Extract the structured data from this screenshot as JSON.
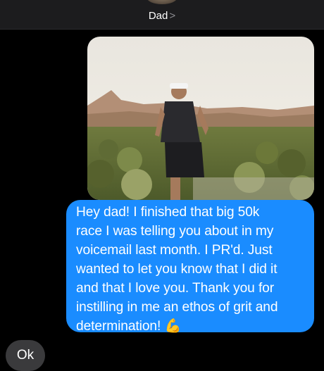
{
  "header": {
    "contact_name": "Dad",
    "chevron": ">"
  },
  "photo_message": {
    "subject": "man running on trail"
  },
  "sent_message": {
    "lines": [
      "Hey dad! I finished that big 50k",
      "race I was telling you about in my",
      "voicemail last month. I PR'd. Just",
      "wanted to let you know that I did it",
      "and that I love you. Thank you for",
      "instilling in me an ethos of grit and",
      "determination!"
    ],
    "emoji": "💪"
  },
  "received_message": {
    "text": "Ok"
  },
  "colors": {
    "sent_bubble": "#1a8cff",
    "received_bubble": "#3a3a3c",
    "header": "#1c1c1e",
    "background": "#000000"
  }
}
